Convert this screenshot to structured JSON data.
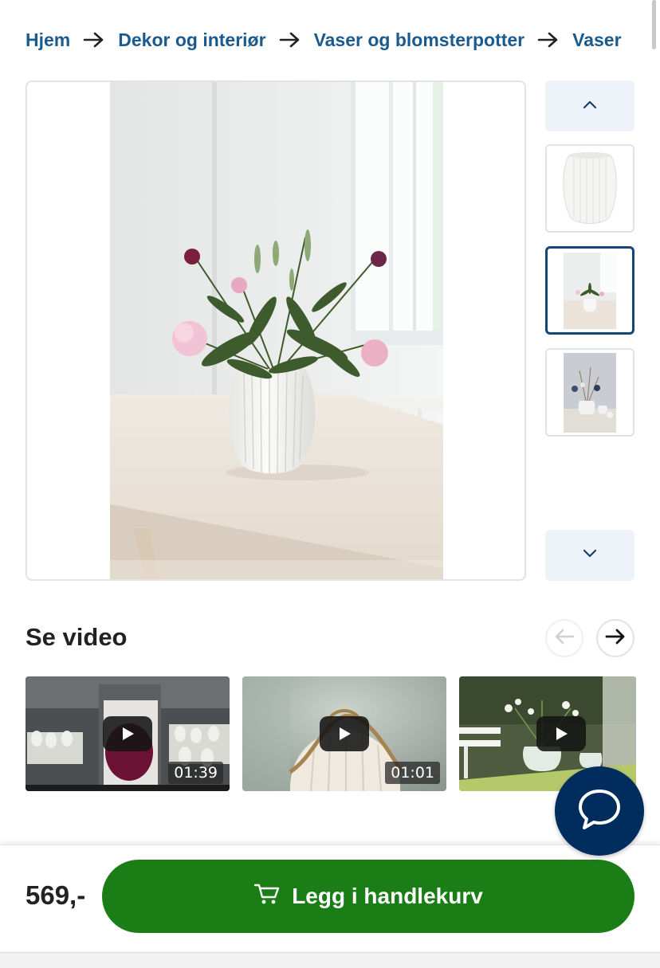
{
  "breadcrumb": {
    "items": [
      {
        "label": "Hjem"
      },
      {
        "label": "Dekor og interiør"
      },
      {
        "label": "Vaser og blomsterpotter"
      },
      {
        "label": "Vaser"
      }
    ]
  },
  "gallery": {
    "main_image": "vase-with-flowers-photo",
    "nav_up_icon": "chevron-up-icon",
    "nav_down_icon": "chevron-down-icon",
    "thumbnails": [
      {
        "image": "white-ribbed-vase-product",
        "active": false
      },
      {
        "image": "vase-with-flowers-on-table",
        "active": true
      },
      {
        "image": "vases-with-dried-flowers",
        "active": false
      }
    ]
  },
  "videos": {
    "title": "Se video",
    "prev_icon": "arrow-left-icon",
    "next_icon": "arrow-right-icon",
    "items": [
      {
        "duration": "01:39",
        "thumbnail": "factory-worker-holding-vase"
      },
      {
        "duration": "01:01",
        "thumbnail": "vase-with-raffia-ribbon"
      },
      {
        "duration": "",
        "thumbnail": "garden-vase-with-flowers"
      }
    ]
  },
  "chat": {
    "icon": "chat-bubble-icon"
  },
  "purchase": {
    "price": "569,-",
    "add_to_cart_label": "Legg i handlekurv",
    "cart_icon": "shopping-cart-icon"
  },
  "colors": {
    "link": "#1b5a8e",
    "cta_green": "#1b7d15",
    "chat_navy": "#002d5d",
    "active_thumb_border": "#13477a"
  }
}
